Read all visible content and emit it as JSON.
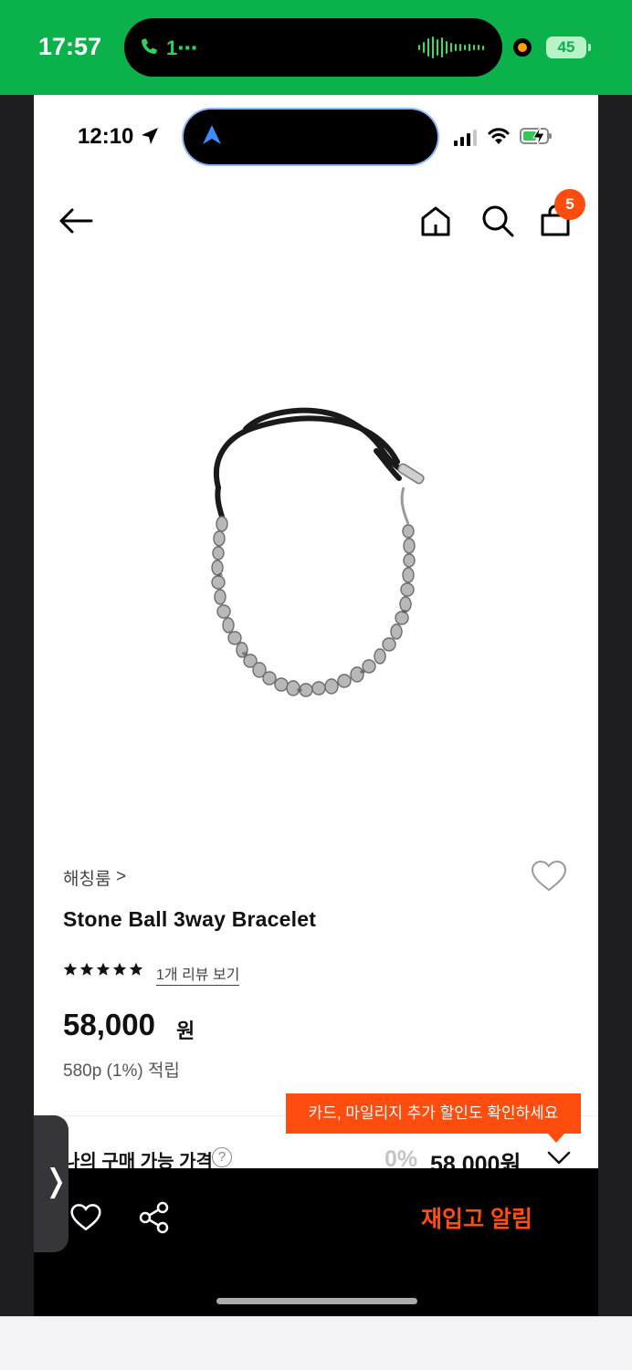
{
  "outer_status": {
    "time": "17:57",
    "call_text": "1⋯",
    "battery": "45"
  },
  "inner_status": {
    "time": "12:10"
  },
  "header": {
    "cart_count": "5"
  },
  "product": {
    "brand": "해칭룸",
    "brand_chevron": ">",
    "title": "Stone Ball 3way Bracelet",
    "review_link": "1개 리뷰 보기",
    "rating_stars": 5,
    "price": "58,000",
    "price_unit": "원",
    "points": "580p (1%) 적립"
  },
  "discount_tooltip": "카드, 마일리지 추가 할인도 확인하세요",
  "available_price": {
    "label": "나의 구매 가능 가격",
    "help": "?",
    "percent": "0%",
    "price": "58,000원"
  },
  "bottom_bar": {
    "restock_label": "재입고 알림"
  },
  "side_handle": {
    "label": "❭"
  },
  "colors": {
    "accent": "#ff4c0f",
    "outer_bar": "#0bb14b"
  }
}
